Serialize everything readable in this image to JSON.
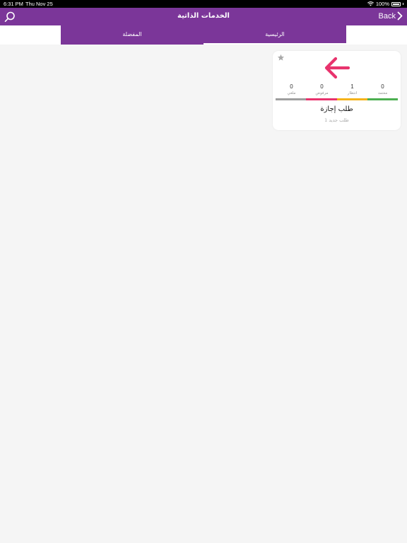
{
  "status_bar": {
    "time": "6:31 PM",
    "date": "Thu Nov 25",
    "battery": "100%"
  },
  "nav": {
    "title": "الخدمات الذاتية",
    "back_label": "Back"
  },
  "tabs": [
    {
      "label": "المفضلة",
      "active": false
    },
    {
      "label": "الرئيسية",
      "active": true
    }
  ],
  "card": {
    "title": "طلب إجازة",
    "subtitle": "1 طلب جديد",
    "stats": [
      {
        "value": "0",
        "label": "معتمد",
        "color": "#4caf50"
      },
      {
        "value": "1",
        "label": "انتظار",
        "color": "#f5b31b"
      },
      {
        "value": "0",
        "label": "مرفوض",
        "color": "#e8336d"
      },
      {
        "value": "0",
        "label": "ملغي",
        "color": "#9e9e9e"
      }
    ],
    "arrow_color": "#e8336d",
    "star_color": "#aaaaaa"
  },
  "colors": {
    "brand": "#7b3699",
    "background": "#f5f5f5"
  }
}
